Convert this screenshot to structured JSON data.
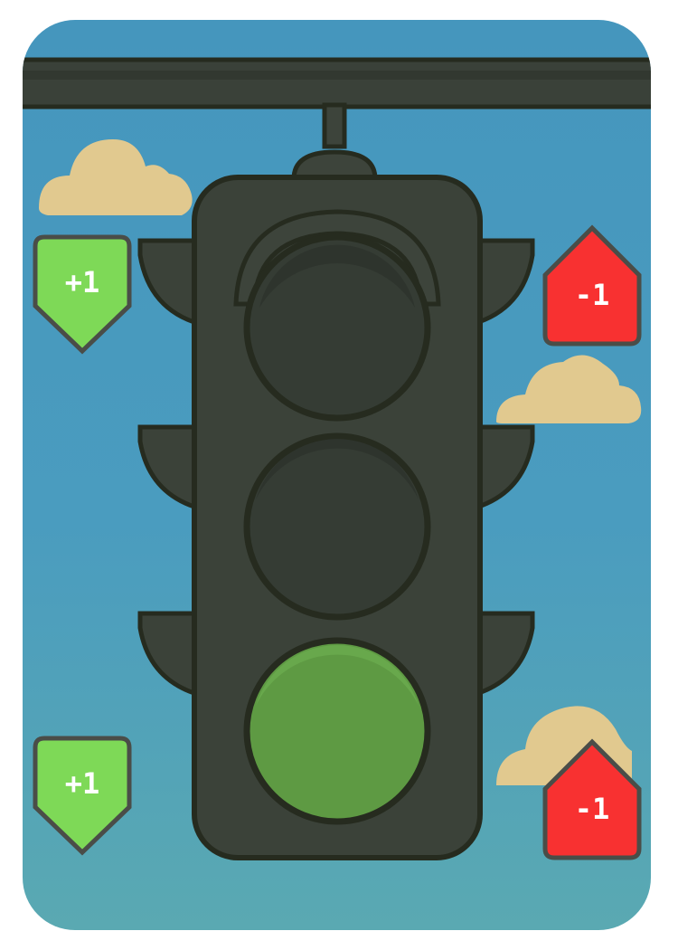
{
  "card": {
    "sky_color": "#4596bd",
    "pole_color": "#3a4139",
    "housing_color": "#3b4239",
    "outline_color": "#262b1f",
    "cloud_color": "#e1c98f"
  },
  "traffic_light": {
    "active_lamp": "green",
    "lamps": [
      {
        "name": "top",
        "state": "off"
      },
      {
        "name": "middle",
        "state": "off"
      },
      {
        "name": "bottom",
        "state": "on",
        "color": "#5e9a43"
      }
    ]
  },
  "badges": {
    "top_left": {
      "label": "+1",
      "color": "#7ed957",
      "icon": "shield-down-icon"
    },
    "bottom_left": {
      "label": "+1",
      "color": "#7ed957",
      "icon": "shield-down-icon"
    },
    "top_right": {
      "label": "-1",
      "color": "#f83131",
      "icon": "house-up-icon"
    },
    "bottom_right": {
      "label": "-1",
      "color": "#f83131",
      "icon": "house-up-icon"
    }
  }
}
